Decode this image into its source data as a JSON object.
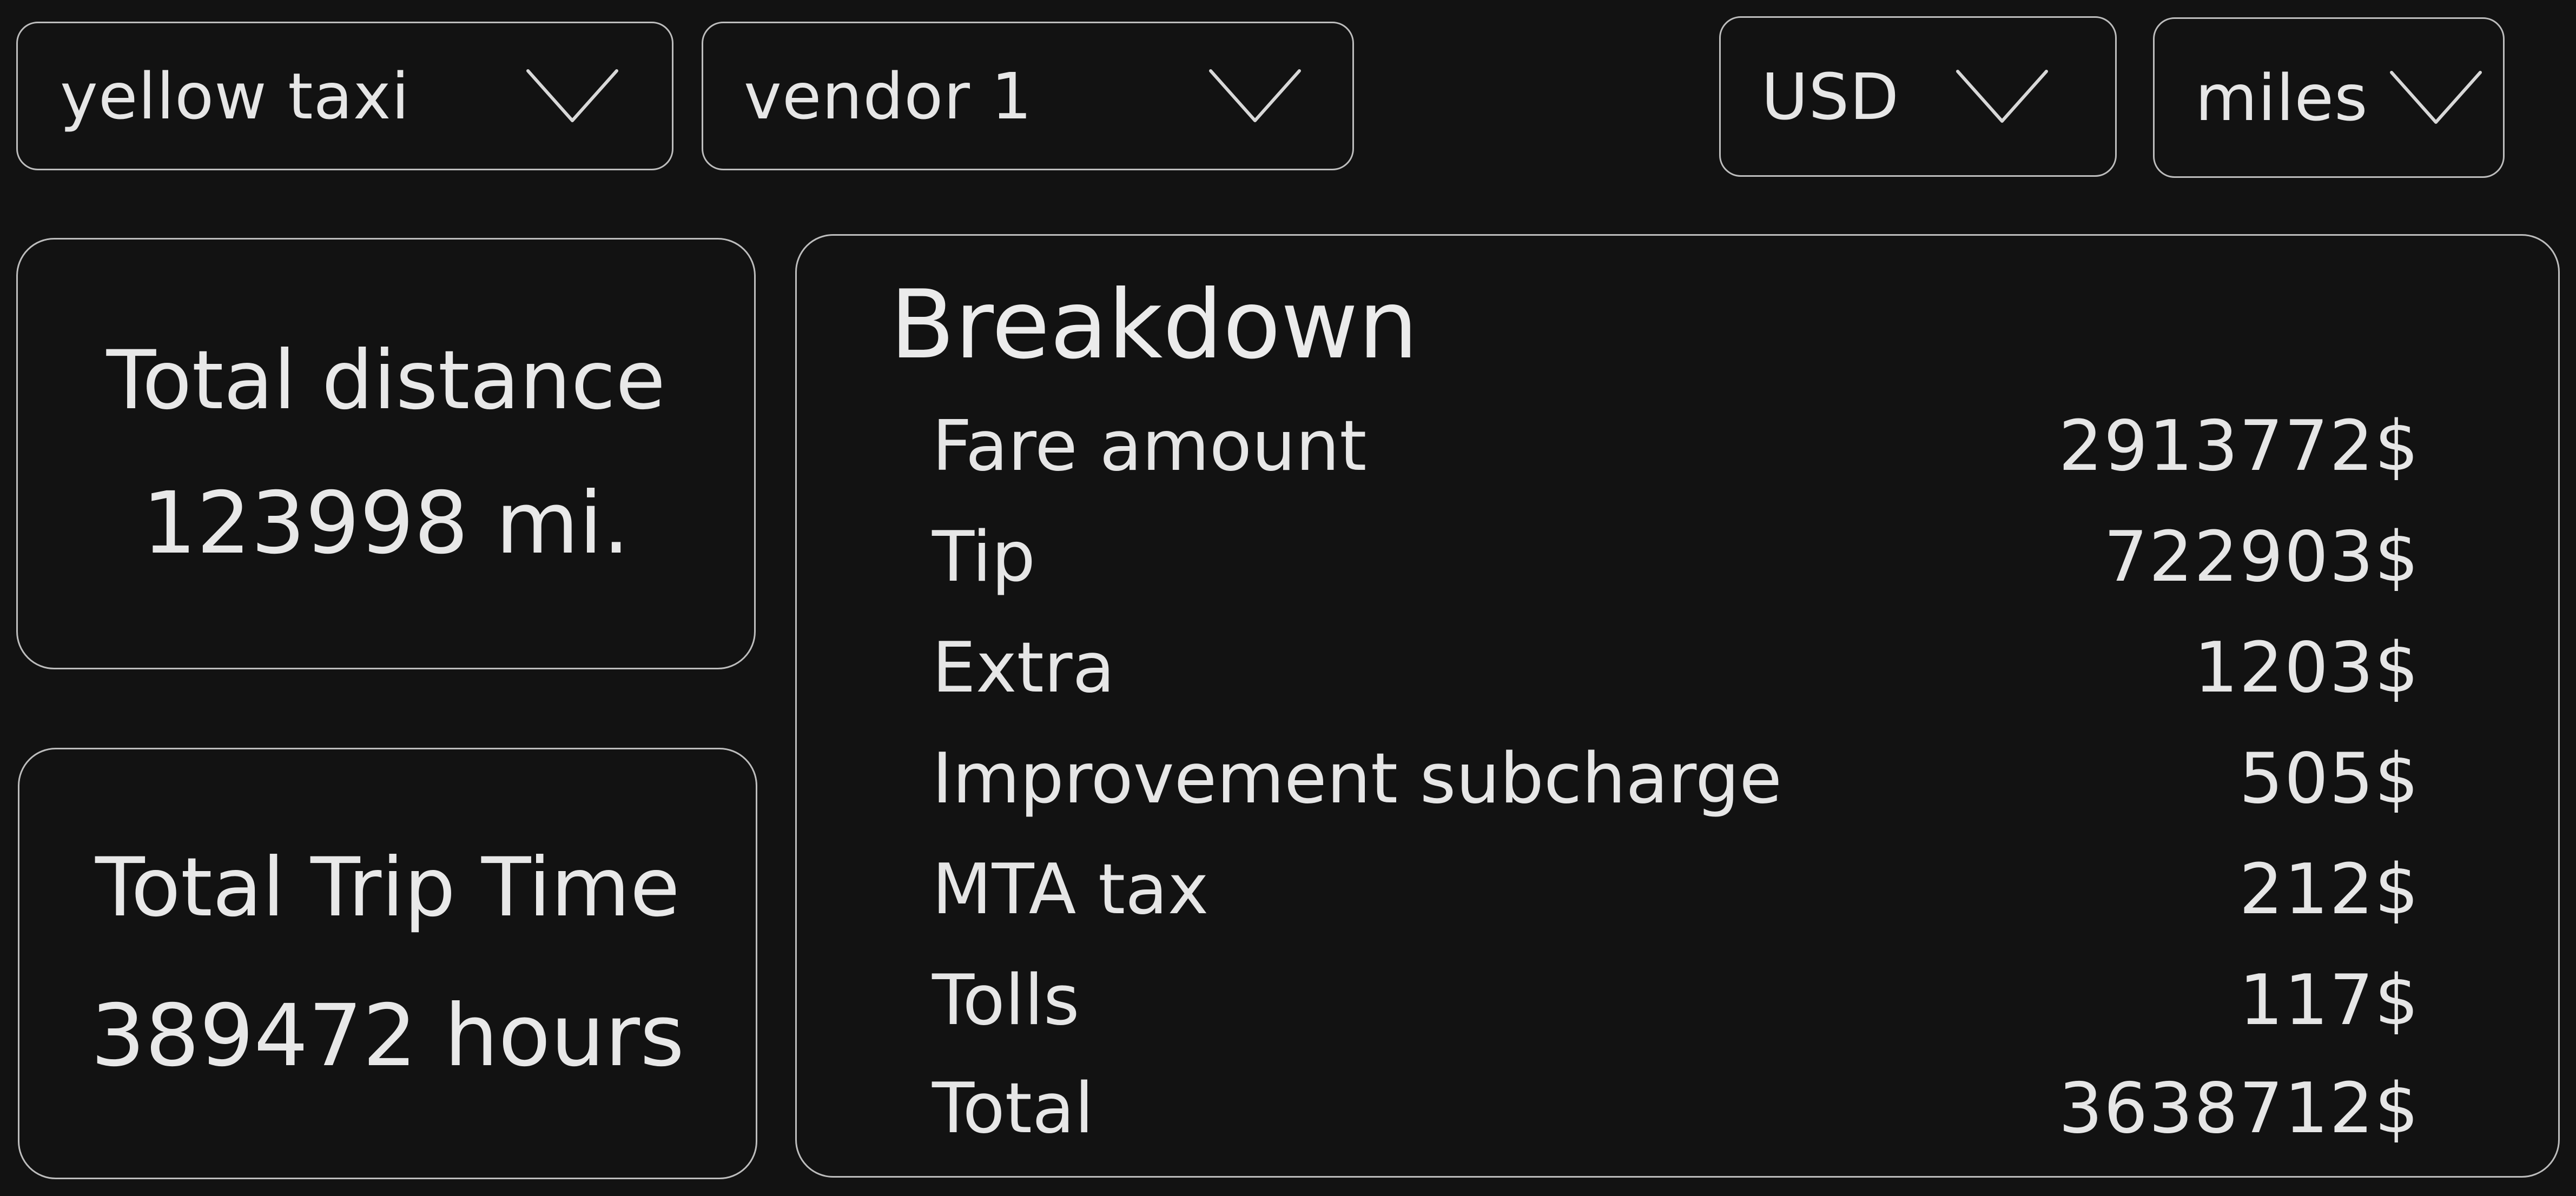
{
  "filters": {
    "dataset": {
      "selected": "yellow taxi",
      "icon": "chevron-down-icon"
    },
    "vendor": {
      "selected": "vendor 1",
      "icon": "chevron-down-icon"
    },
    "currency": {
      "selected": "USD",
      "icon": "chevron-down-icon"
    },
    "unit": {
      "selected": "miles",
      "icon": "chevron-down-icon"
    }
  },
  "stats": {
    "distance": {
      "title": "Total distance",
      "value": "123998 mi."
    },
    "trip_time": {
      "title": "Total Trip Time",
      "value": "389472 hours"
    }
  },
  "breakdown": {
    "title": "Breakdown",
    "rows": [
      {
        "label": "Fare amount",
        "value": "2913772$"
      },
      {
        "label": "Tip",
        "value": "722903$"
      },
      {
        "label": "Extra",
        "value": "1203$"
      },
      {
        "label": "Improvement subcharge",
        "value": "505$"
      },
      {
        "label": "MTA tax",
        "value": "212$"
      },
      {
        "label": "Tolls",
        "value": "117$"
      },
      {
        "label": "Total",
        "value": "3638712$"
      }
    ]
  },
  "colors": {
    "background": "#121212",
    "border": "#bdbdbd",
    "text": "#e6e6e6"
  }
}
